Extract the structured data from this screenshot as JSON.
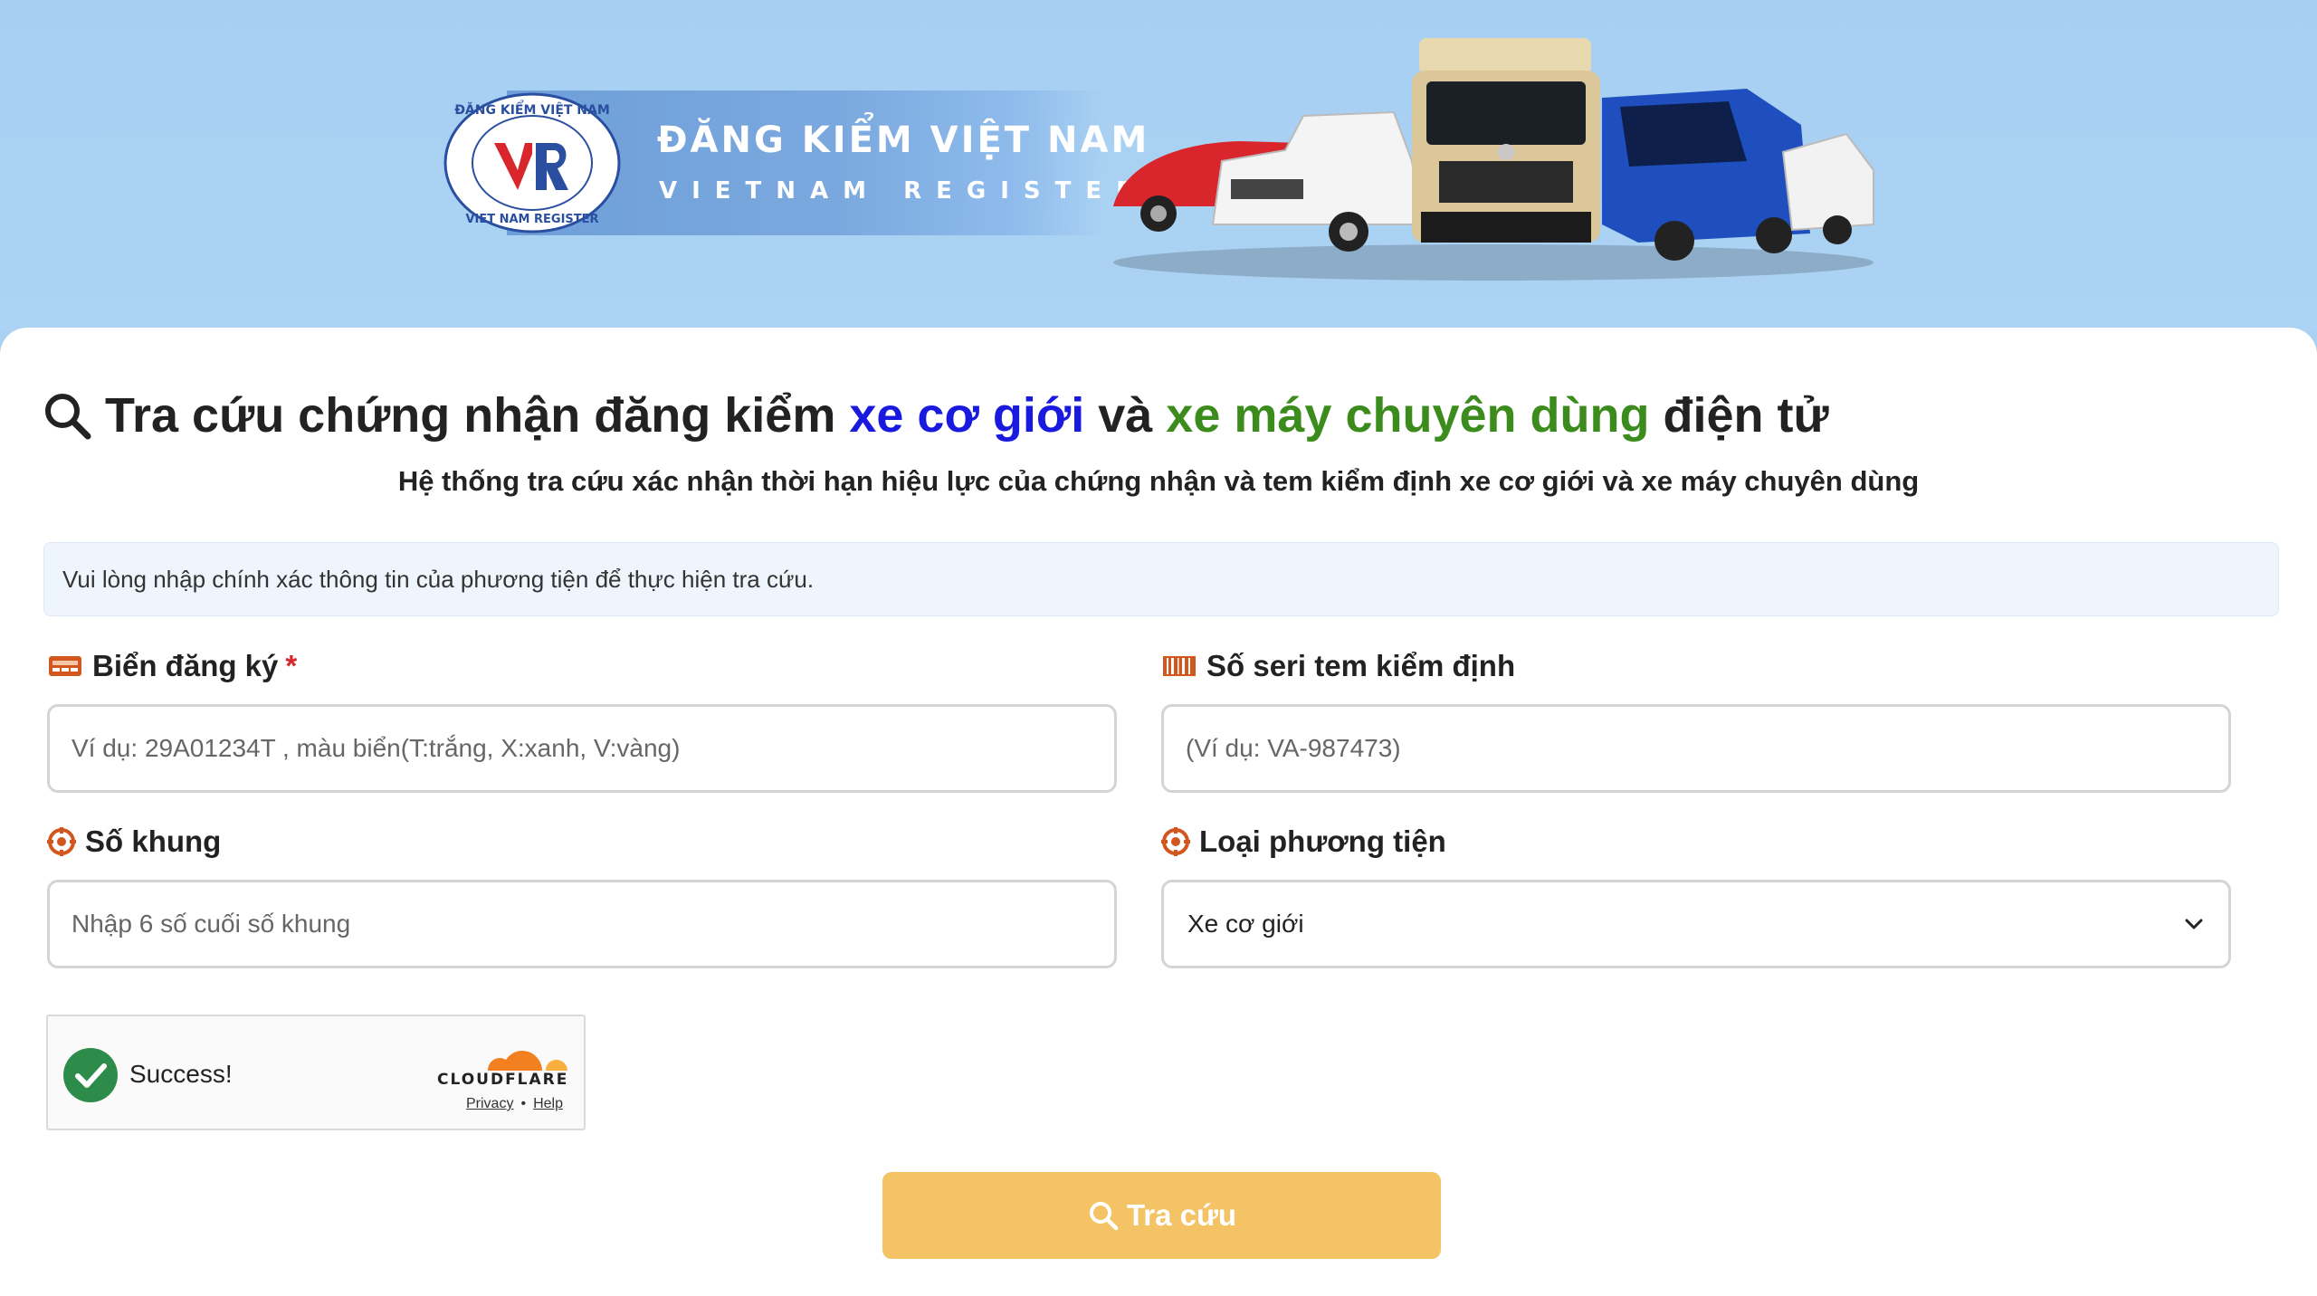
{
  "banner": {
    "brand_name_vn": "ĐĂNG KIỂM VIỆT NAM",
    "brand_name_en": "VIETNAM REGISTER",
    "seal_text_top": "ĐĂNG KIỂM VIỆT NAM",
    "seal_text_bottom": "VIET NAM REGISTER",
    "seal_letters": "VR"
  },
  "page": {
    "title_part1": "Tra cứu chứng nhận đăng kiểm ",
    "title_highlight1": "xe cơ giới",
    "title_part2": " và ",
    "title_highlight2": "xe máy chuyên dùng",
    "title_part3": " điện tử",
    "subtitle": "Hệ thống tra cứu xác nhận thời hạn hiệu lực của chứng nhận và tem kiểm định xe cơ giới và xe máy chuyên dùng",
    "notice": "Vui lòng nhập chính xác thông tin của phương tiện để thực hiện tra cứu."
  },
  "form": {
    "plate": {
      "label": "Biển đăng ký",
      "required_mark": "*",
      "placeholder": "Ví dụ: 29A01234T , màu biển(T:trắng, X:xanh, V:vàng)",
      "icon": "license-plate-icon"
    },
    "serial": {
      "label": "Số seri tem kiểm định",
      "placeholder": "(Ví dụ: VA-987473)",
      "icon": "barcode-icon"
    },
    "frame": {
      "label": "Số khung",
      "placeholder": "Nhập 6 số cuối số khung",
      "icon": "target-icon"
    },
    "vehicle_type": {
      "label": "Loại phương tiện",
      "selected": "Xe cơ giới",
      "icon": "target-icon"
    }
  },
  "captcha": {
    "status": "Success!",
    "brand": "CLOUDFLARE",
    "privacy": "Privacy",
    "separator": "•",
    "help": "Help"
  },
  "submit": {
    "label": "Tra cứu",
    "icon": "search-icon"
  },
  "colors": {
    "banner_bg": "#a9d1f2",
    "highlight_blue": "#1a1adf",
    "highlight_green": "#3c8c1d",
    "icon_orange": "#d2571f",
    "submit_bg": "#f3c366",
    "required_red": "#d9262c"
  }
}
